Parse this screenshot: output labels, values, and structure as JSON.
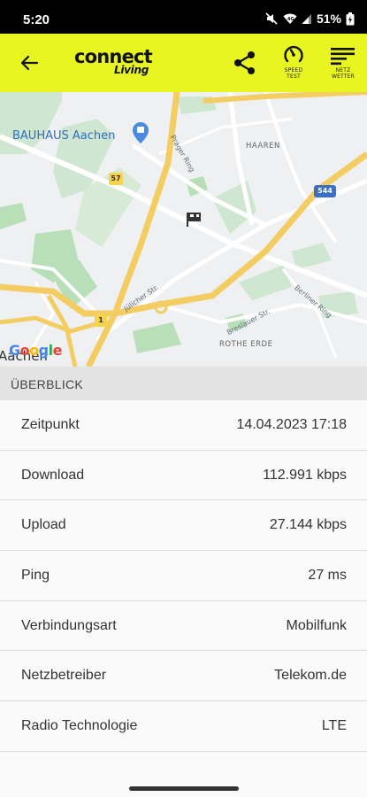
{
  "status_bar": {
    "time": "5:20",
    "battery": "51%"
  },
  "app_bar": {
    "brand_main": "connect",
    "brand_sub": "Living",
    "speed_test_label": "SPEED TEST",
    "netz_wetter_label": "NETZ WETTER",
    "accent_color": "#e8f521"
  },
  "map": {
    "poi": "BAUHAUS Aachen",
    "districts": [
      "HAAREN",
      "ROTHE ERDE"
    ],
    "streets": [
      "Jülicher Str.",
      "Berliner Ring",
      "Breslauer Str.",
      "Prager Ring"
    ],
    "road_shields": [
      "57",
      "1",
      "544"
    ],
    "city": "Aachen",
    "attribution": "Google"
  },
  "section": {
    "title": "ÜBERBLICK"
  },
  "details": [
    {
      "label": "Zeitpunkt",
      "value": "14.04.2023 17:18"
    },
    {
      "label": "Download",
      "value": "112.991 kbps"
    },
    {
      "label": "Upload",
      "value": "27.144 kbps"
    },
    {
      "label": "Ping",
      "value": "27 ms"
    },
    {
      "label": "Verbindungsart",
      "value": "Mobilfunk"
    },
    {
      "label": "Netzbetreiber",
      "value": "Telekom.de"
    },
    {
      "label": "Radio Technologie",
      "value": "LTE"
    }
  ]
}
